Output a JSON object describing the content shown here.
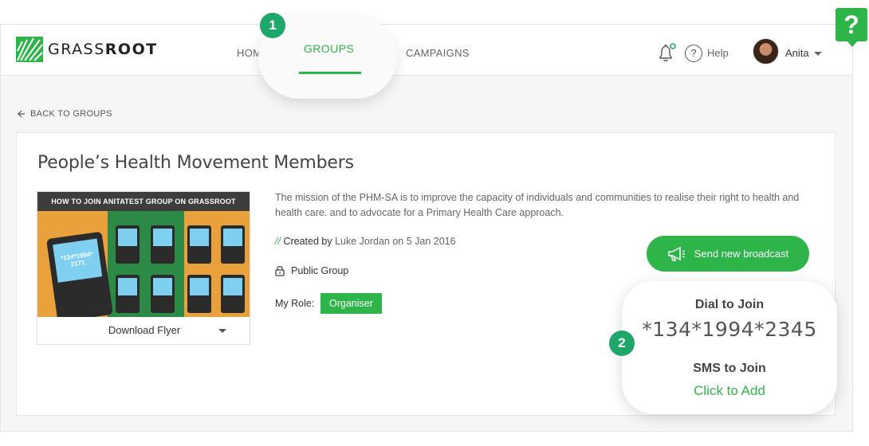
{
  "brand": {
    "name_light": "GRASS",
    "name_bold": "ROOT",
    "accent": "#2db54a"
  },
  "nav": {
    "home": "HOM",
    "groups": "GROUPS",
    "campaigns": "CAMPAIGNS"
  },
  "header": {
    "help_label": "Help",
    "user_name": "Anita",
    "help_badge": "?"
  },
  "callouts": {
    "one": "1",
    "two": "2"
  },
  "back_label": "BACK TO GROUPS",
  "group": {
    "title": "People’s Health Movement Members",
    "description": "The mission of the PHM-SA is to improve the capacity of individuals and communities to realise their right to health and health care. and to advocate for a Primary Health Care approach.",
    "created_slashes": "//",
    "created_label": "Created by",
    "created_value": "Luke Jordan on 5 Jan 2016",
    "visibility": "Public Group",
    "role_label": "My Role:",
    "role_value": "Organiser"
  },
  "flyer": {
    "heading": "HOW TO JOIN ANITATEST GROUP ON GRASSROOT",
    "code": "*134*1994*",
    "code2": "2171",
    "download_label": "Download Flyer"
  },
  "broadcast_label": "Send new broadcast",
  "join": {
    "dial_label": "Dial to Join",
    "dial_code": "*134*1994*2345",
    "sms_label": "SMS to Join",
    "sms_link": "Click to Add"
  }
}
